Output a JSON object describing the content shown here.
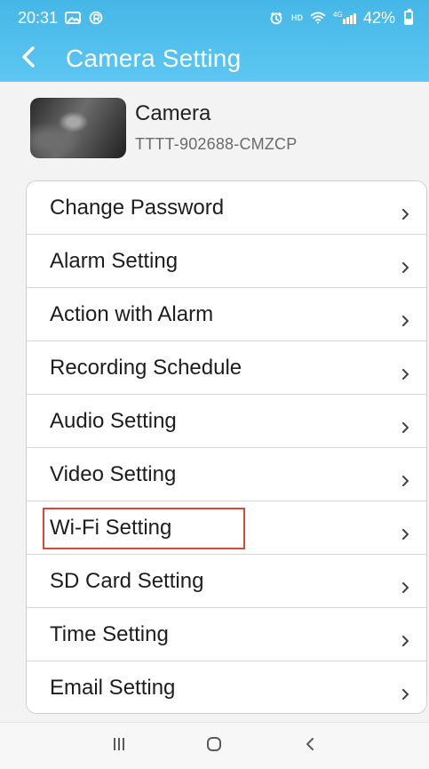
{
  "colors": {
    "header_top": "#45b7e7",
    "header_bottom": "#5ec6f3",
    "highlight_border": "#d94834",
    "nav_icon": "#5a5a5a"
  },
  "status_bar": {
    "time": "20:31",
    "left_icons": [
      "gallery-icon",
      "app-r-icon"
    ],
    "right_icons": [
      "alarm-clock-icon",
      "hd-badge",
      "wifi-icon",
      "signal-4g-icon",
      "battery-icon"
    ],
    "hd_label": "HD",
    "network_label": "4G",
    "battery_percent": "42%",
    "battery_level": 0.42
  },
  "app_bar": {
    "back_icon": "back-chevron-icon",
    "title": "Camera Setting"
  },
  "camera": {
    "name": "Camera",
    "id": "TTTT-902688-CMZCP"
  },
  "menu": {
    "items": [
      {
        "label": "Change Password"
      },
      {
        "label": "Alarm Setting"
      },
      {
        "label": "Action with Alarm"
      },
      {
        "label": "Recording Schedule"
      },
      {
        "label": "Audio Setting"
      },
      {
        "label": "Video Setting"
      },
      {
        "label": "Wi-Fi Setting"
      },
      {
        "label": "SD Card Setting"
      },
      {
        "label": "Time Setting"
      },
      {
        "label": "Email Setting"
      }
    ],
    "chevron_icon": "chevron-right-icon"
  },
  "nav_bar": {
    "icons": [
      "recent-apps-icon",
      "home-icon",
      "back-icon"
    ]
  }
}
